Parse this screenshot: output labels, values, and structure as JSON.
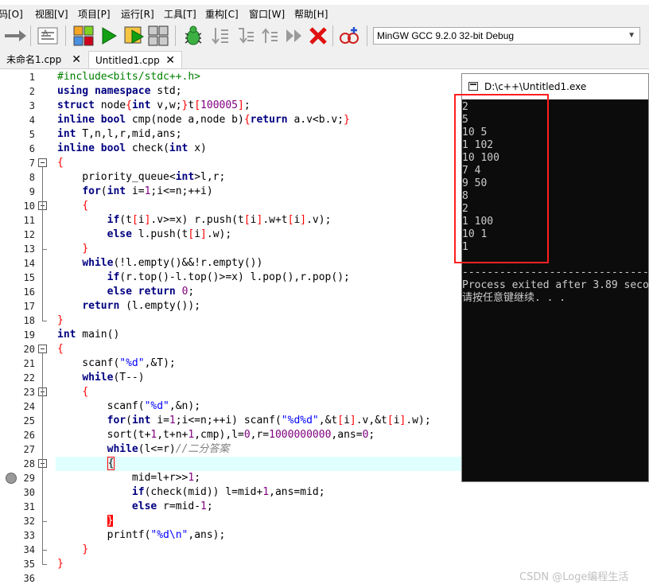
{
  "menu": [
    "码[O]",
    "视图[V]",
    "项目[P]",
    "运行[R]",
    "工具[T]",
    "重构[C]",
    "窗口[W]",
    "帮助[H]"
  ],
  "compiler": {
    "selected": "MinGW GCC 9.2.0 32-bit Debug"
  },
  "tabs": [
    {
      "label": "未命名1.cpp"
    },
    {
      "label": "Untitled1.cpp"
    }
  ],
  "tab_close": "✕",
  "line_numbers": [
    "1",
    "2",
    "3",
    "4",
    "5",
    "6",
    "7",
    "8",
    "9",
    "10",
    "11",
    "12",
    "13",
    "14",
    "15",
    "16",
    "17",
    "18",
    "19",
    "20",
    "21",
    "22",
    "23",
    "24",
    "25",
    "26",
    "27",
    "28",
    "29",
    "30",
    "31",
    "32",
    "33",
    "34",
    "35",
    "36"
  ],
  "code": [
    [
      {
        "t": "pp",
        "v": "#include<bits/stdc++.h>"
      }
    ],
    [
      {
        "t": "kw",
        "v": "using"
      },
      {
        "t": "id",
        "v": " "
      },
      {
        "t": "kw",
        "v": "namespace"
      },
      {
        "t": "id",
        "v": " std;"
      }
    ],
    [
      {
        "t": "kw",
        "v": "struct"
      },
      {
        "t": "id",
        "v": " node"
      },
      {
        "t": "sym",
        "v": "{"
      },
      {
        "t": "kw",
        "v": "int"
      },
      {
        "t": "id",
        "v": " v,w;"
      },
      {
        "t": "sym",
        "v": "}"
      },
      {
        "t": "id",
        "v": "t"
      },
      {
        "t": "sym",
        "v": "["
      },
      {
        "t": "num",
        "v": "100005"
      },
      {
        "t": "sym",
        "v": "]"
      },
      {
        "t": "id",
        "v": ";"
      }
    ],
    [
      {
        "t": "kw",
        "v": "inline"
      },
      {
        "t": "id",
        "v": " "
      },
      {
        "t": "kw",
        "v": "bool"
      },
      {
        "t": "id",
        "v": " cmp(node a,node b)"
      },
      {
        "t": "sym",
        "v": "{"
      },
      {
        "t": "kw",
        "v": "return"
      },
      {
        "t": "id",
        "v": " a.v<b.v;"
      },
      {
        "t": "sym",
        "v": "}"
      }
    ],
    [
      {
        "t": "kw",
        "v": "int"
      },
      {
        "t": "id",
        "v": " T,n,l,r,mid,ans;"
      }
    ],
    [
      {
        "t": "kw",
        "v": "inline"
      },
      {
        "t": "id",
        "v": " "
      },
      {
        "t": "kw",
        "v": "bool"
      },
      {
        "t": "id",
        "v": " check("
      },
      {
        "t": "kw",
        "v": "int"
      },
      {
        "t": "id",
        "v": " x)"
      }
    ],
    [
      {
        "t": "sym",
        "v": "{"
      }
    ],
    [
      {
        "t": "id",
        "v": "    priority_queue<"
      },
      {
        "t": "kw",
        "v": "int"
      },
      {
        "t": "id",
        "v": ">l,r;"
      }
    ],
    [
      {
        "t": "id",
        "v": "    "
      },
      {
        "t": "kw",
        "v": "for"
      },
      {
        "t": "id",
        "v": "("
      },
      {
        "t": "kw",
        "v": "int"
      },
      {
        "t": "id",
        "v": " i="
      },
      {
        "t": "num",
        "v": "1"
      },
      {
        "t": "id",
        "v": ";i<=n;++i)"
      }
    ],
    [
      {
        "t": "id",
        "v": "    "
      },
      {
        "t": "sym",
        "v": "{"
      }
    ],
    [
      {
        "t": "id",
        "v": "        "
      },
      {
        "t": "kw",
        "v": "if"
      },
      {
        "t": "id",
        "v": "(t"
      },
      {
        "t": "sym",
        "v": "["
      },
      {
        "t": "id",
        "v": "i"
      },
      {
        "t": "sym",
        "v": "]"
      },
      {
        "t": "id",
        "v": ".v>=x) r.push(t"
      },
      {
        "t": "sym",
        "v": "["
      },
      {
        "t": "id",
        "v": "i"
      },
      {
        "t": "sym",
        "v": "]"
      },
      {
        "t": "id",
        "v": ".w+t"
      },
      {
        "t": "sym",
        "v": "["
      },
      {
        "t": "id",
        "v": "i"
      },
      {
        "t": "sym",
        "v": "]"
      },
      {
        "t": "id",
        "v": ".v);"
      }
    ],
    [
      {
        "t": "id",
        "v": "        "
      },
      {
        "t": "kw",
        "v": "else"
      },
      {
        "t": "id",
        "v": " l.push(t"
      },
      {
        "t": "sym",
        "v": "["
      },
      {
        "t": "id",
        "v": "i"
      },
      {
        "t": "sym",
        "v": "]"
      },
      {
        "t": "id",
        "v": ".w);"
      }
    ],
    [
      {
        "t": "id",
        "v": "    "
      },
      {
        "t": "sym",
        "v": "}"
      }
    ],
    [
      {
        "t": "id",
        "v": "    "
      },
      {
        "t": "kw",
        "v": "while"
      },
      {
        "t": "id",
        "v": "(!l.empty()&&!r.empty())"
      }
    ],
    [
      {
        "t": "id",
        "v": "        "
      },
      {
        "t": "kw",
        "v": "if"
      },
      {
        "t": "id",
        "v": "(r.top()-l.top()>=x) l.pop(),r.pop();"
      }
    ],
    [
      {
        "t": "id",
        "v": "        "
      },
      {
        "t": "kw",
        "v": "else"
      },
      {
        "t": "id",
        "v": " "
      },
      {
        "t": "kw",
        "v": "return"
      },
      {
        "t": "id",
        "v": " "
      },
      {
        "t": "num",
        "v": "0"
      },
      {
        "t": "id",
        "v": ";"
      }
    ],
    [
      {
        "t": "id",
        "v": "    "
      },
      {
        "t": "kw",
        "v": "return"
      },
      {
        "t": "id",
        "v": " (l.empty());"
      }
    ],
    [
      {
        "t": "sym",
        "v": "}"
      }
    ],
    [
      {
        "t": "kw",
        "v": "int"
      },
      {
        "t": "id",
        "v": " main()"
      }
    ],
    [
      {
        "t": "sym",
        "v": "{"
      }
    ],
    [
      {
        "t": "id",
        "v": "    scanf("
      },
      {
        "t": "str",
        "v": "\"%d\""
      },
      {
        "t": "id",
        "v": ",&T);"
      }
    ],
    [
      {
        "t": "id",
        "v": "    "
      },
      {
        "t": "kw",
        "v": "while"
      },
      {
        "t": "id",
        "v": "(T--)"
      }
    ],
    [
      {
        "t": "id",
        "v": "    "
      },
      {
        "t": "sym",
        "v": "{"
      }
    ],
    [
      {
        "t": "id",
        "v": "        scanf("
      },
      {
        "t": "str",
        "v": "\"%d\""
      },
      {
        "t": "id",
        "v": ",&n);"
      }
    ],
    [
      {
        "t": "id",
        "v": "        "
      },
      {
        "t": "kw",
        "v": "for"
      },
      {
        "t": "id",
        "v": "("
      },
      {
        "t": "kw",
        "v": "int"
      },
      {
        "t": "id",
        "v": " i="
      },
      {
        "t": "num",
        "v": "1"
      },
      {
        "t": "id",
        "v": ";i<=n;++i) scanf("
      },
      {
        "t": "str",
        "v": "\"%d%d\""
      },
      {
        "t": "id",
        "v": ",&t"
      },
      {
        "t": "sym",
        "v": "["
      },
      {
        "t": "id",
        "v": "i"
      },
      {
        "t": "sym",
        "v": "]"
      },
      {
        "t": "id",
        "v": ".v,&t"
      },
      {
        "t": "sym",
        "v": "["
      },
      {
        "t": "id",
        "v": "i"
      },
      {
        "t": "sym",
        "v": "]"
      },
      {
        "t": "id",
        "v": ".w);"
      }
    ],
    [
      {
        "t": "id",
        "v": "        sort(t+"
      },
      {
        "t": "num",
        "v": "1"
      },
      {
        "t": "id",
        "v": ",t+n+"
      },
      {
        "t": "num",
        "v": "1"
      },
      {
        "t": "id",
        "v": ",cmp),l="
      },
      {
        "t": "num",
        "v": "0"
      },
      {
        "t": "id",
        "v": ",r="
      },
      {
        "t": "num",
        "v": "1000000000"
      },
      {
        "t": "id",
        "v": ",ans="
      },
      {
        "t": "num",
        "v": "0"
      },
      {
        "t": "id",
        "v": ";"
      }
    ],
    [
      {
        "t": "id",
        "v": "        "
      },
      {
        "t": "kw",
        "v": "while"
      },
      {
        "t": "id",
        "v": "(l<=r)"
      },
      {
        "t": "cmt",
        "v": "//二分答案"
      }
    ],
    [
      {
        "t": "id",
        "v": "        "
      },
      {
        "t": "bx",
        "v": "{"
      }
    ],
    [
      {
        "t": "id",
        "v": "            mid=l+r>>"
      },
      {
        "t": "num",
        "v": "1"
      },
      {
        "t": "id",
        "v": ";"
      }
    ],
    [
      {
        "t": "id",
        "v": "            "
      },
      {
        "t": "kw",
        "v": "if"
      },
      {
        "t": "id",
        "v": "(check(mid)) l=mid+"
      },
      {
        "t": "num",
        "v": "1"
      },
      {
        "t": "id",
        "v": ",ans=mid;"
      }
    ],
    [
      {
        "t": "id",
        "v": "            "
      },
      {
        "t": "kw",
        "v": "else"
      },
      {
        "t": "id",
        "v": " r=mid-"
      },
      {
        "t": "num",
        "v": "1"
      },
      {
        "t": "id",
        "v": ";"
      }
    ],
    [
      {
        "t": "id",
        "v": "        "
      },
      {
        "t": "bxr",
        "v": "}"
      }
    ],
    [
      {
        "t": "id",
        "v": "        printf("
      },
      {
        "t": "str",
        "v": "\"%d\\n\""
      },
      {
        "t": "id",
        "v": ",ans);"
      }
    ],
    [
      {
        "t": "id",
        "v": "    "
      },
      {
        "t": "sym",
        "v": "}"
      }
    ],
    [
      {
        "t": "sym",
        "v": "}"
      }
    ],
    [
      {
        "t": "id",
        "v": ""
      }
    ]
  ],
  "console": {
    "title": "D:\\c++\\Untitled1.exe",
    "lines": [
      "2",
      "5",
      "10 5",
      "1 102",
      "10 100",
      "7 4",
      "9 50",
      "8",
      "2",
      "1 100",
      "10 1",
      "1",
      "",
      "--------------------------------",
      "Process exited after 3.89 seco",
      "请按任意键继续. . ."
    ]
  },
  "watermark": "CSDN @Loge编程生活",
  "colors": {
    "keyword": "#000080",
    "preprocessor": "#008000",
    "number": "#800080",
    "string": "#0000ff",
    "symbol": "#ff0000",
    "comment": "#808080",
    "current_line": "#e0ffff",
    "annotation_box": "#ff2020"
  }
}
